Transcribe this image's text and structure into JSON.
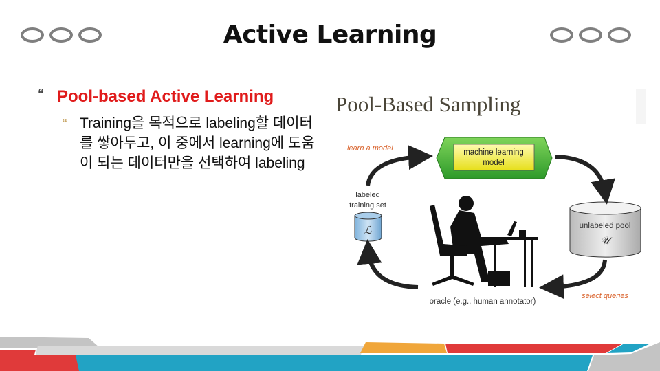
{
  "slide": {
    "title": "Active Learning",
    "bullets": [
      {
        "level": 1,
        "text": "Pool-based Active Learning",
        "bullet_icon": "quote-bullet-icon"
      },
      {
        "level": 2,
        "text": "Training을 목적으로 labeling할 데이터를 쌓아두고, 이 중에서 learning에 도움이 되는 데이터만을 선택하여 labeling",
        "bullet_icon": "quote-bullet-icon"
      }
    ],
    "bullet_glyph": "“"
  },
  "diagram": {
    "title": "Pool-Based Sampling",
    "model_label_1": "machine learning",
    "model_label_2": "model",
    "learn": "learn a model",
    "labeled_1": "labeled",
    "labeled_2": "training set",
    "labeled_symbol": "ℒ",
    "unlabeled": "unlabeled pool",
    "unlabeled_symbol": "𝒰",
    "select": "select queries",
    "oracle": "oracle (e.g., human annotator)"
  },
  "colors": {
    "title_red": "#e01b1b",
    "accent_blue": "#22a3c4",
    "accent_red": "#e03a3a",
    "accent_orange": "#f0a63a",
    "annotation_orange": "#d9622b"
  }
}
